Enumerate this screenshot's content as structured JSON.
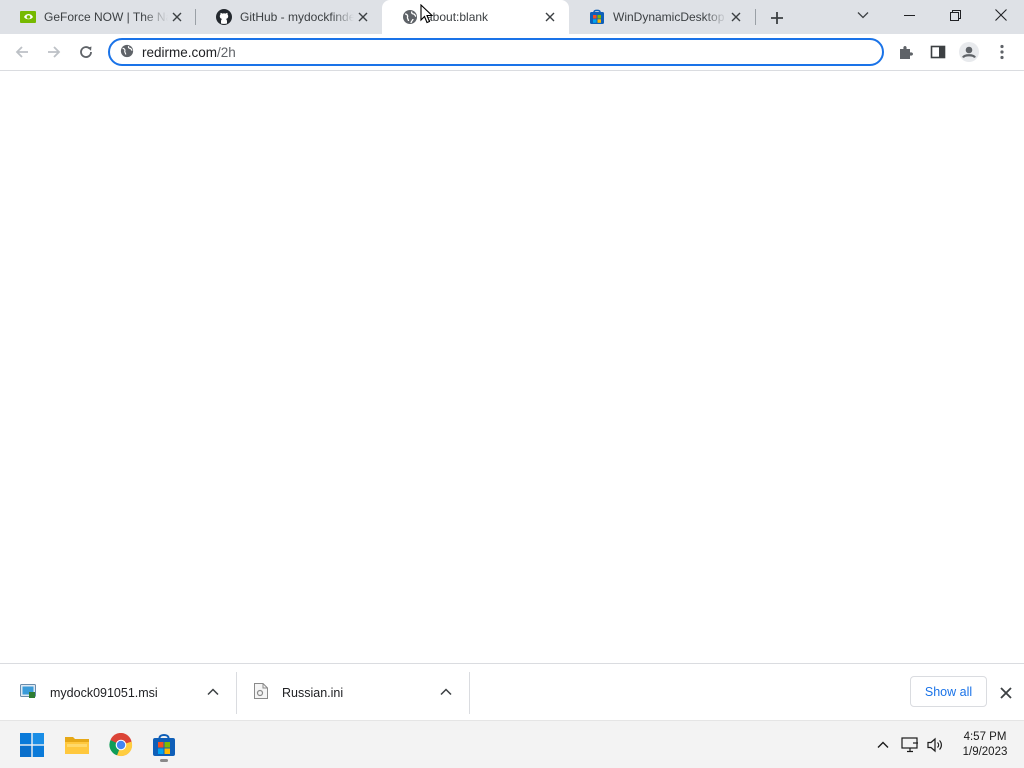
{
  "browser": {
    "tabs": [
      {
        "title": "GeForce NOW | The Na",
        "icon": "nvidia-icon"
      },
      {
        "title": "GitHub - mydockfinder",
        "icon": "github-icon"
      },
      {
        "title": "about:blank",
        "icon": "globe-icon",
        "active": true
      },
      {
        "title": "WinDynamicDesktop -",
        "icon": "store-icon"
      }
    ],
    "omnibox": {
      "host": "redirme.com",
      "path": "/2h"
    }
  },
  "downloads": {
    "items": [
      {
        "name": "mydock091051.msi",
        "icon": "msi-file-icon"
      },
      {
        "name": "Russian.ini",
        "icon": "ini-file-icon"
      }
    ],
    "show_all_label": "Show all"
  },
  "taskbar": {
    "apps": [
      "start-icon",
      "file-explorer-icon",
      "chrome-icon",
      "microsoft-store-icon"
    ],
    "time": "4:57 PM",
    "date": "1/9/2023"
  },
  "colors": {
    "accent": "#1a73e8",
    "tabstrip": "#dee1e6",
    "taskbar": "#f3f3f3"
  }
}
